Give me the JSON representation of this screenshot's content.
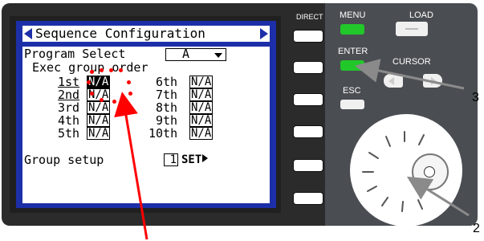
{
  "screen": {
    "title": "Sequence Configuration",
    "program_select_label": "Program Select",
    "program_select_value": "A",
    "exec_group_order_label": "Exec group order",
    "orders": [
      {
        "label": "1st",
        "value": "N/A"
      },
      {
        "label": "2nd",
        "value": "N/A"
      },
      {
        "label": "3rd",
        "value": "N/A"
      },
      {
        "label": "4th",
        "value": "N/A"
      },
      {
        "label": "5th",
        "value": "N/A"
      },
      {
        "label": "6th",
        "value": "N/A"
      },
      {
        "label": "7th",
        "value": "N/A"
      },
      {
        "label": "8th",
        "value": "N/A"
      },
      {
        "label": "9th",
        "value": "N/A"
      },
      {
        "label": "10th",
        "value": "N/A"
      }
    ],
    "group_setup_label": "Group setup",
    "group_setup_value": "1",
    "set_label": "SET"
  },
  "hardware": {
    "direct_label": "DIRECT",
    "menu_label": "MENU",
    "load_label": "LOAD",
    "enter_label": "ENTER",
    "cursor_label": "CURSOR",
    "esc_label": "ESC"
  },
  "callouts": {
    "c3": "3",
    "c2": "2"
  },
  "colors": {
    "lcd_blue": "#1d2fa8",
    "indicator_green": "#22c72a",
    "annotation_red": "#ff0000"
  }
}
